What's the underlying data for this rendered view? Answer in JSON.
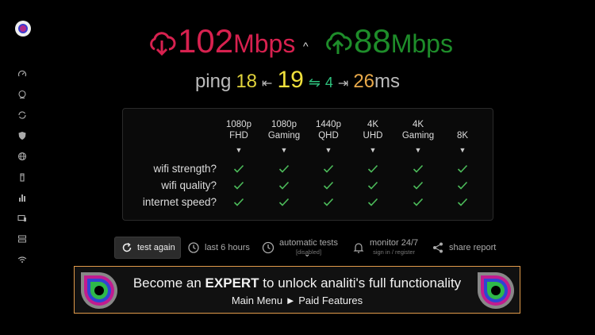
{
  "app": {
    "logo_icon": "analiti-logo"
  },
  "sidebar": {
    "items": [
      {
        "icon": "speedometer-icon"
      },
      {
        "icon": "report-icon"
      },
      {
        "icon": "refresh-icon"
      },
      {
        "icon": "shield-icon"
      },
      {
        "icon": "globe-icon"
      },
      {
        "icon": "router-icon"
      },
      {
        "icon": "bar-chart-icon"
      },
      {
        "icon": "devices-icon"
      },
      {
        "icon": "list-icon"
      },
      {
        "icon": "wifi-icon"
      }
    ]
  },
  "speed": {
    "download_value": "102",
    "download_unit": "Mbps",
    "upload_value": "88",
    "upload_unit": "Mbps",
    "download_color": "#d7214f",
    "upload_color": "#1e8d2a"
  },
  "ping": {
    "label": "ping",
    "min": "18",
    "median": "19",
    "jitter": "4",
    "max": "26",
    "unit": "ms"
  },
  "table": {
    "columns": [
      {
        "line1": "1080p",
        "line2": "FHD"
      },
      {
        "line1": "1080p",
        "line2": "Gaming"
      },
      {
        "line1": "1440p",
        "line2": "QHD"
      },
      {
        "line1": "4K",
        "line2": "UHD"
      },
      {
        "line1": "4K",
        "line2": "Gaming"
      },
      {
        "line1": "",
        "line2": "8K"
      }
    ],
    "rows": [
      {
        "label": "wifi strength?",
        "values": [
          true,
          true,
          true,
          true,
          true,
          true
        ]
      },
      {
        "label": "wifi quality?",
        "values": [
          true,
          true,
          true,
          true,
          true,
          true
        ]
      },
      {
        "label": "internet speed?",
        "values": [
          true,
          true,
          true,
          true,
          true,
          true
        ]
      }
    ],
    "check_color": "#4cbb5a"
  },
  "actions": {
    "test_again": "test again",
    "last_hours": "last 6 hours",
    "automatic_tests": "automatic tests",
    "automatic_tests_sub": "[disabled]",
    "monitor": "monitor 24/7",
    "monitor_sub": "sign in / register",
    "share": "share report"
  },
  "banner": {
    "title_pre": "Become an ",
    "title_bold": "EXPERT",
    "title_post": " to unlock analiti's full functionality",
    "subtitle": "Main Menu ► Paid Features",
    "border_color": "#e09a4a"
  }
}
